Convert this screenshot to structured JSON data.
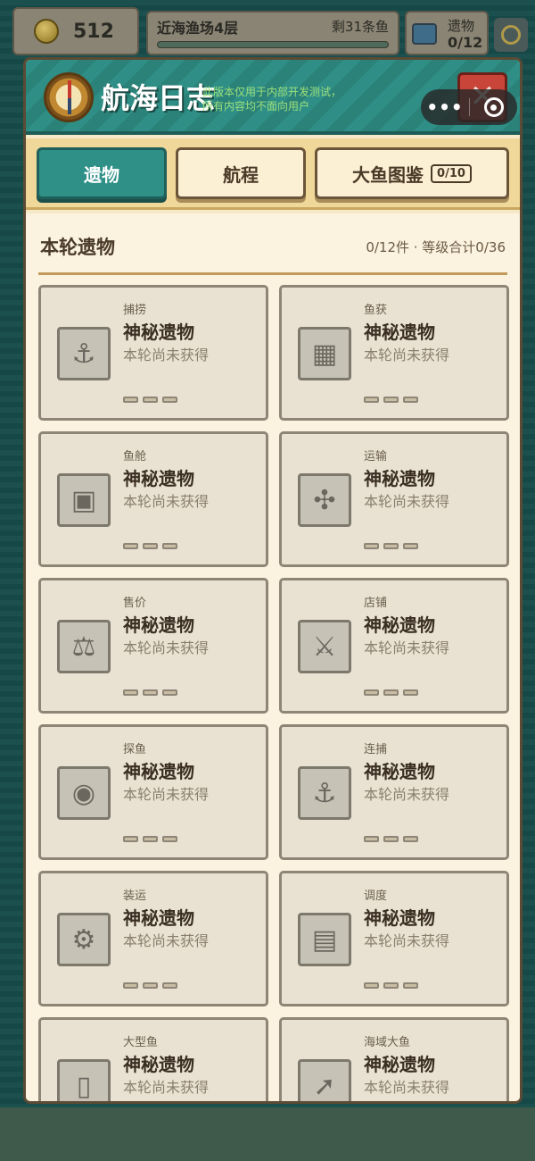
{
  "hud": {
    "coins": "512",
    "stage_name": "近海渔场4层",
    "stage_remaining": "剩31条鱼",
    "relics_label": "遗物",
    "relics_count": "0/12"
  },
  "modal": {
    "title": "航海日志",
    "dev_notice_line1": "此版本仅用于内部开发测试，",
    "dev_notice_line2": "所有内容均不面向用户",
    "close_label": "✕"
  },
  "capsule": {
    "more_label": "•••"
  },
  "tabs": [
    {
      "label": "遗物",
      "active": true
    },
    {
      "label": "航程",
      "active": false
    },
    {
      "label": "大鱼图鉴",
      "badge": "0/10",
      "active": false
    }
  ],
  "section": {
    "title": "本轮遗物",
    "summary": "0/12件 · 等级合计0/36"
  },
  "cards": [
    {
      "category": "捕捞",
      "name": "神秘遗物",
      "status": "本轮尚未获得",
      "icon": "hook-icon"
    },
    {
      "category": "鱼获",
      "name": "神秘遗物",
      "status": "本轮尚未获得",
      "icon": "net-icon"
    },
    {
      "category": "鱼舱",
      "name": "神秘遗物",
      "status": "本轮尚未获得",
      "icon": "safe-icon"
    },
    {
      "category": "运输",
      "name": "神秘遗物",
      "status": "本轮尚未获得",
      "icon": "propeller-icon"
    },
    {
      "category": "售价",
      "name": "神秘遗物",
      "status": "本轮尚未获得",
      "icon": "scale-icon"
    },
    {
      "category": "店铺",
      "name": "神秘遗物",
      "status": "本轮尚未获得",
      "icon": "knife-icon"
    },
    {
      "category": "探鱼",
      "name": "神秘遗物",
      "status": "本轮尚未获得",
      "icon": "sonar-icon"
    },
    {
      "category": "连捕",
      "name": "神秘遗物",
      "status": "本轮尚未获得",
      "icon": "double-hook-icon"
    },
    {
      "category": "装运",
      "name": "神秘遗物",
      "status": "本轮尚未获得",
      "icon": "crane-icon"
    },
    {
      "category": "调度",
      "name": "神秘遗物",
      "status": "本轮尚未获得",
      "icon": "map-icon"
    },
    {
      "category": "大型鱼",
      "name": "神秘遗物",
      "status": "本轮尚未获得",
      "icon": "jar-icon"
    },
    {
      "category": "海域大鱼",
      "name": "神秘遗物",
      "status": "本轮尚未获得",
      "icon": "harpoon-icon"
    }
  ]
}
